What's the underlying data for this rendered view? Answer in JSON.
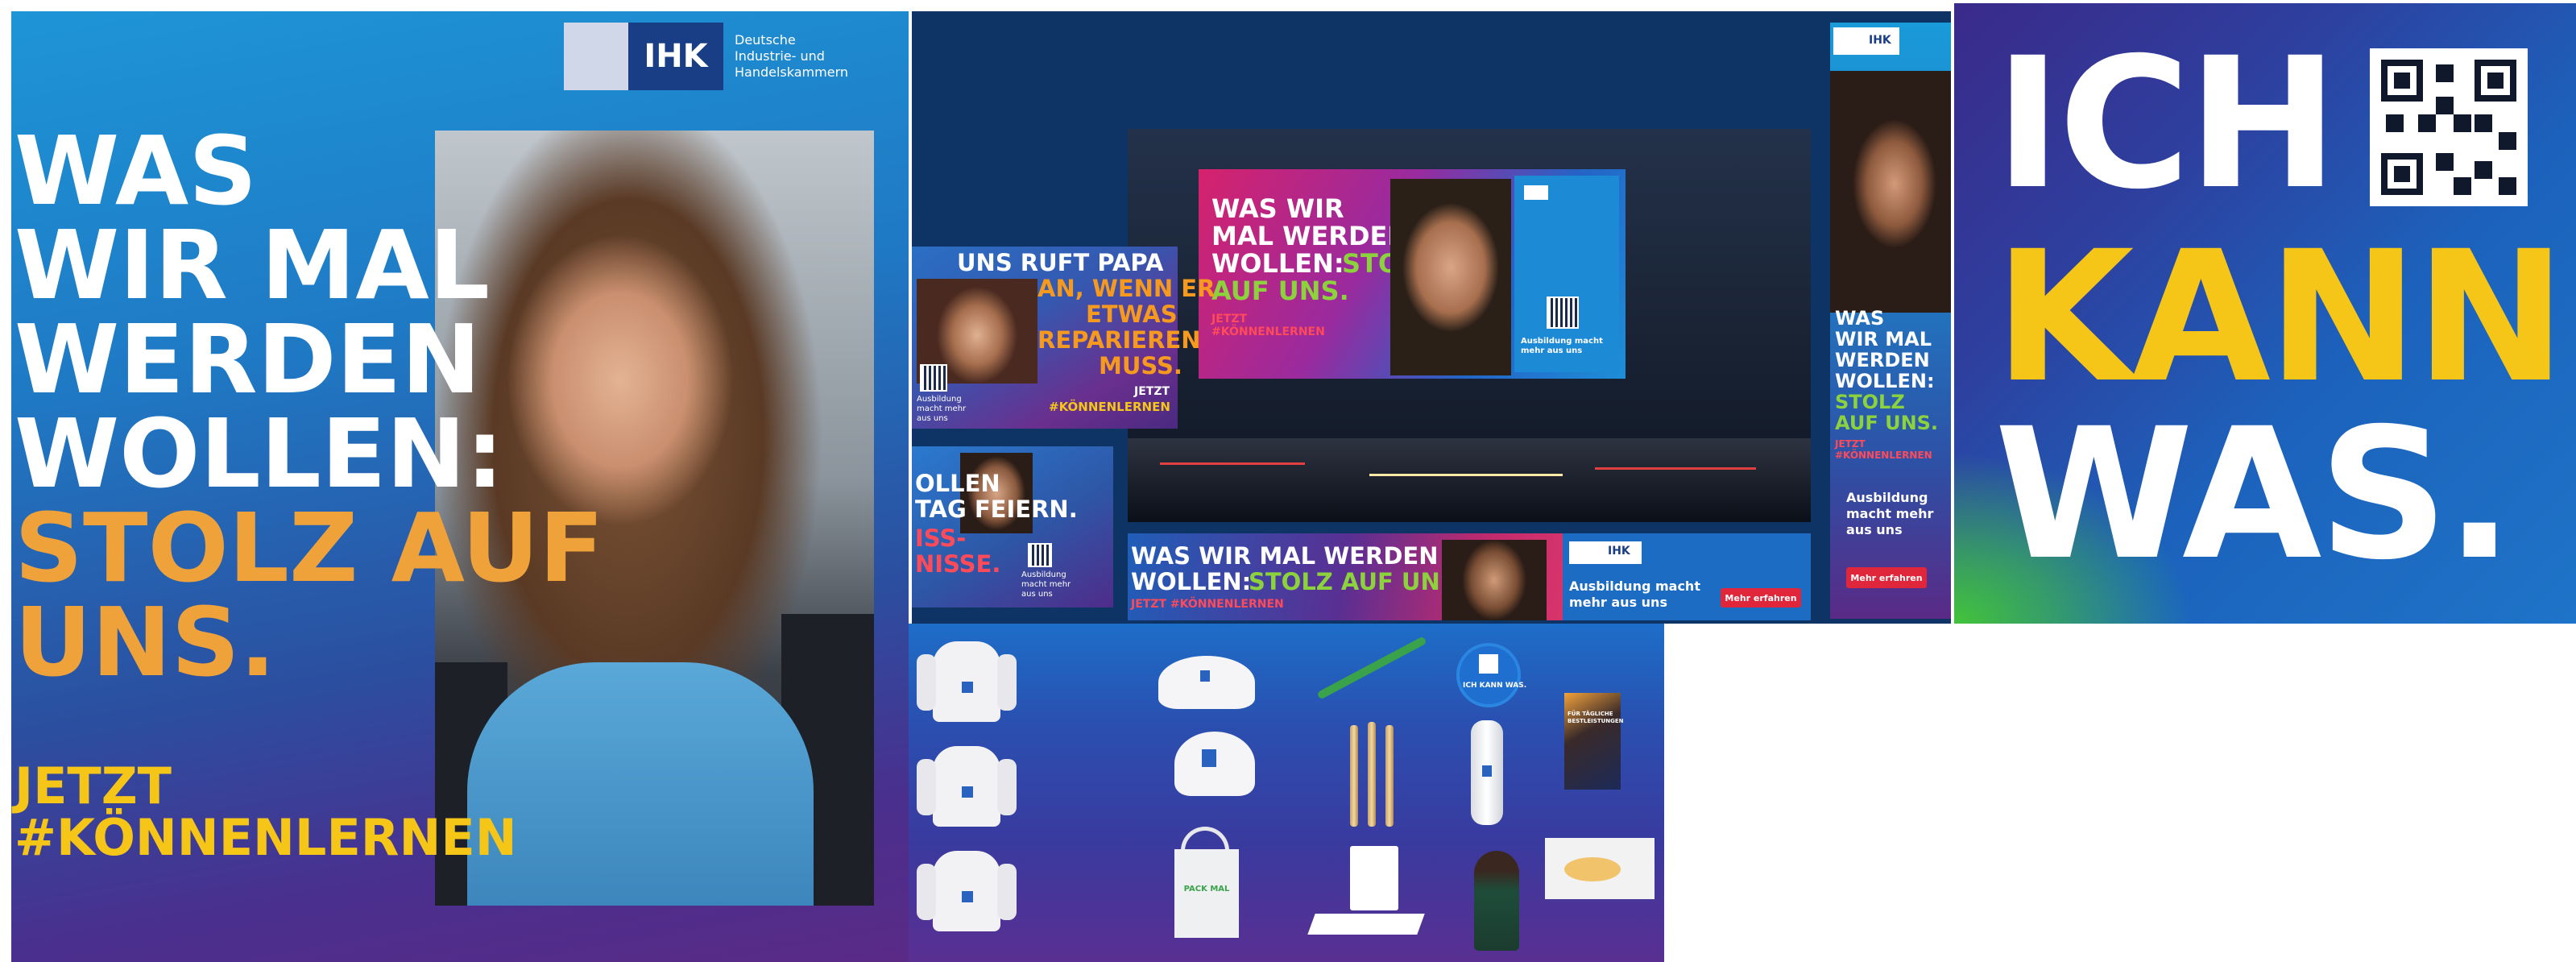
{
  "colors": {
    "brand_blue": "#1a3e86",
    "orange": "#f0a23a",
    "yellow": "#f5c518",
    "green": "#8cd23c",
    "red": "#e0263a"
  },
  "poster": {
    "logo": "IHK",
    "org_line1": "Deutsche",
    "org_line2": "Industrie- und Handelskammern",
    "headline_lines": [
      "WAS",
      "WIR MAL",
      "WERDEN",
      "WOLLEN:"
    ],
    "accent_lines": [
      "STOLZ AUF",
      "UNS."
    ],
    "cta_lines": [
      "JETZT",
      "#KÖNNENLERNEN"
    ]
  },
  "collage": {
    "billboard": {
      "lines": [
        "WAS WIR",
        "MAL WERDEN",
        "WOLLEN:"
      ],
      "accent": "STOLZ",
      "accent2": "AUF UNS.",
      "cta": [
        "JETZT",
        "#KÖNNENLERNEN"
      ],
      "tag": "Ausbildung macht mehr aus uns"
    },
    "ad_papa": {
      "line1": "UNS RUFT PAPA",
      "line2": "AN, WENN ER",
      "line3": "ETWAS",
      "line4": "REPARIEREN",
      "line5": "MUSS.",
      "cta": [
        "JETZT",
        "#KÖNNENLERNEN"
      ],
      "tag": "Ausbildung macht mehr aus uns"
    },
    "ad_feiern": {
      "line1": "OLLEN",
      "line2": "TAG FEIERN.",
      "line3": "ISS-",
      "line4": "NISSE.",
      "tag": "Ausbildung macht mehr aus uns"
    },
    "banner": {
      "line1": "WAS WIR MAL WERDEN",
      "line2a": "WOLLEN:",
      "line2b": "STOLZ AUF UNS.",
      "cta": "JETZT #KÖNNENLERNEN",
      "logo": "IHK",
      "tag": "Ausbildung macht mehr aus uns",
      "button": "Mehr erfahren"
    },
    "skyscraper": {
      "logo": "IHK",
      "lines": [
        "WAS",
        "WIR MAL",
        "WERDEN",
        "WOLLEN:"
      ],
      "accent": [
        "STOLZ",
        "AUF UNS."
      ],
      "cta": "JETZT #KÖNNENLERNEN",
      "tag": "Ausbildung macht mehr aus uns",
      "button": "Mehr erfahren"
    }
  },
  "slogan": {
    "line1": "ICH",
    "line2": "KANN",
    "line3": "WAS."
  },
  "merch": {
    "pin_text": "ICH KANN WAS.",
    "tote_text": "PACK MAL",
    "book_title": "FÜR TÄGLICHE BESTLEISTUNGEN"
  }
}
